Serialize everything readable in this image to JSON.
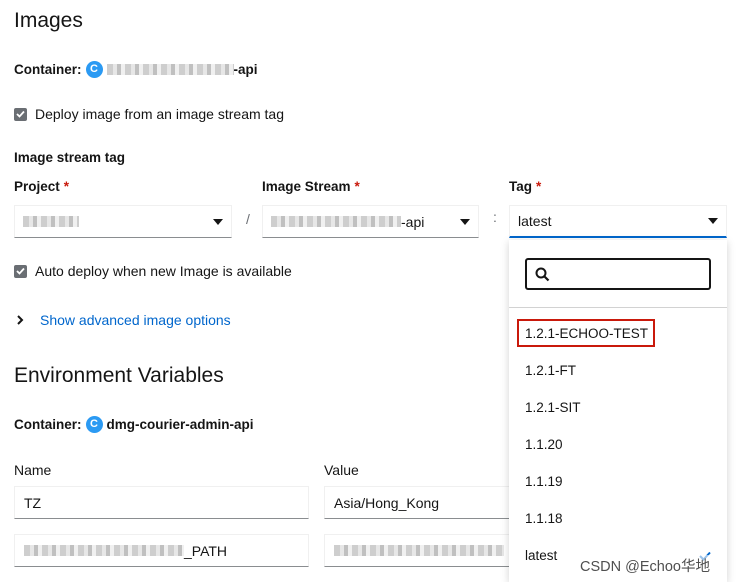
{
  "images": {
    "heading": "Images",
    "container_label": "Container:",
    "container_badge": "C",
    "container_name_suffix": "-api",
    "deploy_checkbox_label": "Deploy image from an image stream tag",
    "image_stream_tag_label": "Image stream tag",
    "project_label": "Project",
    "image_stream_label": "Image Stream",
    "tag_label": "Tag",
    "required_mark": "*",
    "separator_slash": "/",
    "separator_colon": ":",
    "image_stream_value_suffix": "-api",
    "tag_value": "latest",
    "auto_deploy_label": "Auto deploy when new Image is available",
    "advanced_link": "Show advanced image options"
  },
  "tag_dropdown": {
    "search_value": "",
    "options": [
      "1.2.1-ECHOO-TEST",
      "1.2.1-FT",
      "1.2.1-SIT",
      "1.1.20",
      "1.1.19",
      "1.1.18",
      "latest"
    ],
    "highlighted_option": "1.2.1-ECHOO-TEST",
    "selected_option": "latest"
  },
  "env": {
    "heading": "Environment Variables",
    "container_label": "Container:",
    "container_badge": "C",
    "container_name": "dmg-courier-admin-api",
    "name_header": "Name",
    "value_header": "Value",
    "row1_name": "TZ",
    "row1_value": "Asia/Hong_Kong",
    "row2_name_suffix": "_PATH"
  },
  "watermark": "CSDN @Echoo华地",
  "colors": {
    "accent_blue": "#0066cc",
    "badge_blue": "#2b9af3",
    "required_red": "#c9190b",
    "highlight_box": "#c9190b"
  }
}
